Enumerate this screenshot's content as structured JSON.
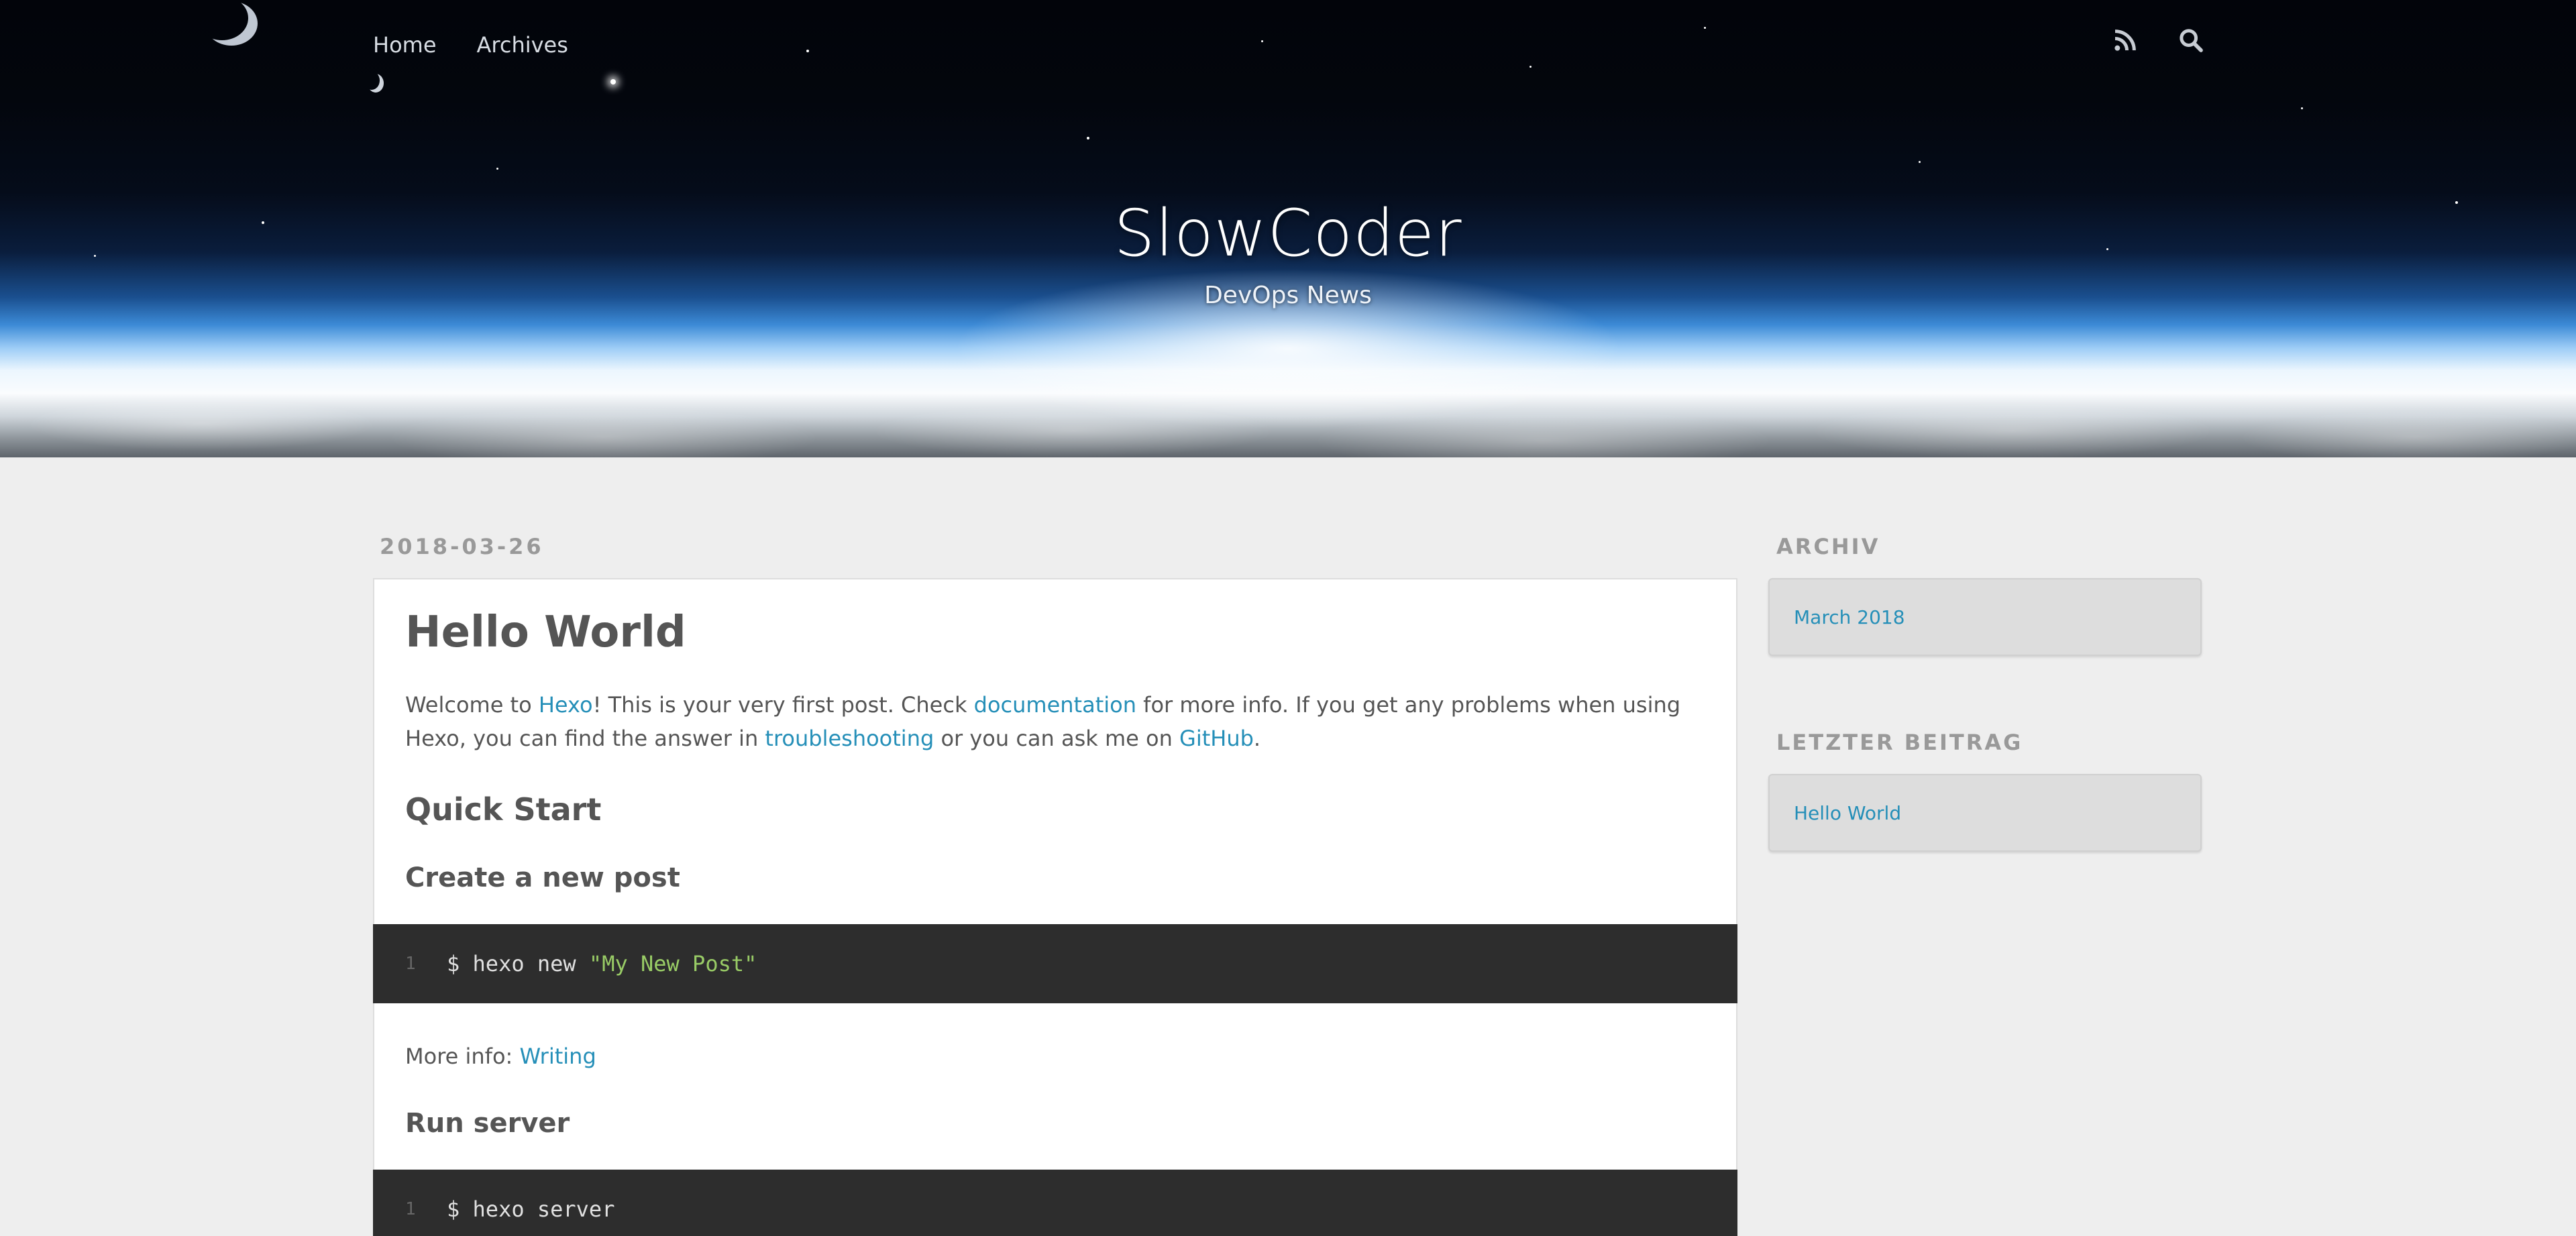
{
  "nav": {
    "items": [
      {
        "label": "Home"
      },
      {
        "label": "Archives"
      }
    ],
    "icons": [
      "rss-icon",
      "search-icon"
    ]
  },
  "site": {
    "title": "SlowCoder",
    "subtitle": "DevOps News"
  },
  "post": {
    "date": "2018-03-26",
    "title": "Hello World",
    "intro": {
      "t1": "Welcome to ",
      "link1": "Hexo",
      "t2": "! This is your very first post. Check ",
      "link2": "documentation",
      "t3": " for more info. If you get any problems when using Hexo, you can find the answer in ",
      "link3": "troubleshooting",
      "t4": " or you can ask me on ",
      "link4": "GitHub",
      "t5": "."
    },
    "quick_start": "Quick Start",
    "create_post": {
      "heading": "Create a new post",
      "code_line_no": "1",
      "code_cmd": "$ hexo new ",
      "code_arg": "\"My New Post\"",
      "more_info_label": "More info: ",
      "more_info_link": "Writing"
    },
    "run_server": {
      "heading": "Run server",
      "code_line_no": "1",
      "code_cmd": "$ hexo server"
    }
  },
  "sidebar": {
    "archive": {
      "title": "ARCHIV",
      "item": "March 2018"
    },
    "recent": {
      "title": "LETZTER BEITRAG",
      "item": "Hello World"
    }
  },
  "colors": {
    "link": "#258fb8",
    "page_bg": "#eeeeee",
    "code_bg": "#2d2d2d",
    "code_string": "#99cc66"
  }
}
